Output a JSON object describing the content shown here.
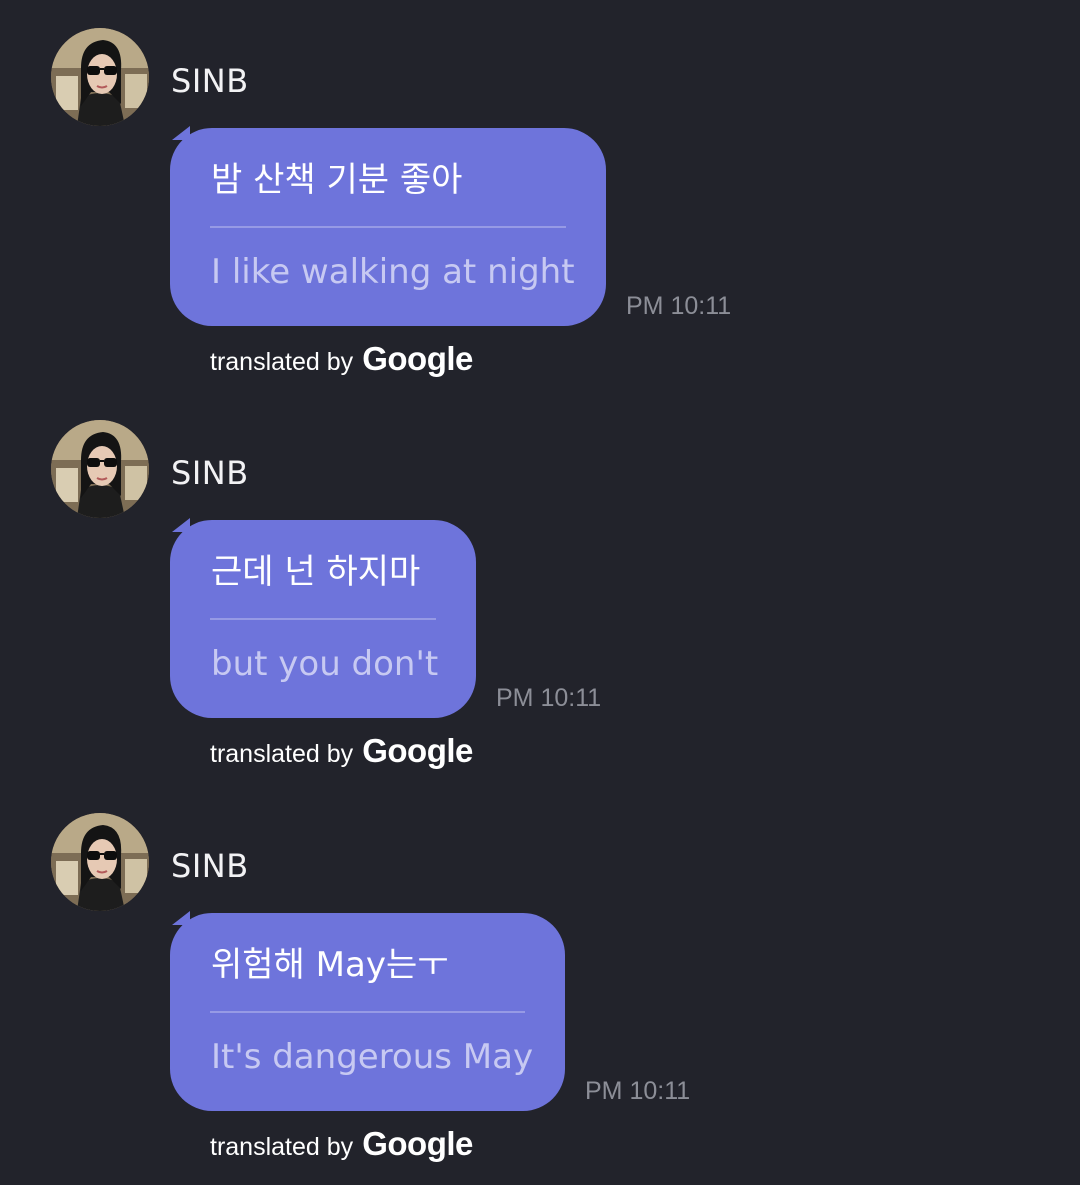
{
  "colors": {
    "background": "#22232b",
    "bubble": "#6e74db",
    "original_text": "#ffffff",
    "translated_text": "#c7c9f2",
    "timestamp": "#8c8e97"
  },
  "messages": [
    {
      "sender": "SINB",
      "original": "밤 산책 기분 좋아",
      "translated": "I like walking at night",
      "time": "PM 10:11",
      "attribution_prefix": "translated by",
      "attribution_brand": "Google",
      "avatar_icon": "profile-photo"
    },
    {
      "sender": "SINB",
      "original": "근데 넌 하지마",
      "translated": "but you don't",
      "time": "PM 10:11",
      "attribution_prefix": "translated by",
      "attribution_brand": "Google",
      "avatar_icon": "profile-photo"
    },
    {
      "sender": "SINB",
      "original": "위험해 May는ㅜ",
      "translated": "It's dangerous May",
      "time": "PM 10:11",
      "attribution_prefix": "translated by",
      "attribution_brand": "Google",
      "avatar_icon": "profile-photo"
    }
  ]
}
